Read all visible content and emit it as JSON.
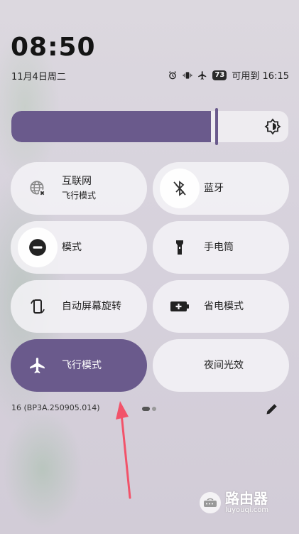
{
  "clock": {
    "time": "08:50",
    "date": "11月4日周二"
  },
  "status": {
    "battery": "73",
    "until": "可用到 16:15"
  },
  "brightness": {
    "level": 0.72
  },
  "tiles": [
    {
      "line1": "互联网",
      "line2": "飞行模式",
      "icon": "globe-off-icon",
      "active": false
    },
    {
      "line1": "蓝牙",
      "icon": "bluetooth-off-icon",
      "active": false
    },
    {
      "line1": "模式",
      "icon": "do-not-disturb-icon",
      "active": false
    },
    {
      "line1": "手电筒",
      "icon": "flashlight-icon",
      "active": false
    },
    {
      "line1": "自动屏幕旋转",
      "icon": "rotate-icon",
      "active": false
    },
    {
      "line1": "省电模式",
      "icon": "battery-saver-icon",
      "active": false
    },
    {
      "line1": "飞行模式",
      "icon": "airplane-icon",
      "active": true
    },
    {
      "line1": "夜间光效",
      "icon": "moon-icon",
      "active": false
    }
  ],
  "footer": {
    "build": "16 (BP3A.250905.014)"
  },
  "watermark": {
    "name": "路由器",
    "url": "luyouqi.com"
  },
  "colors": {
    "accent": "#6a5a8c",
    "annotation_arrow": "#f2536a"
  }
}
